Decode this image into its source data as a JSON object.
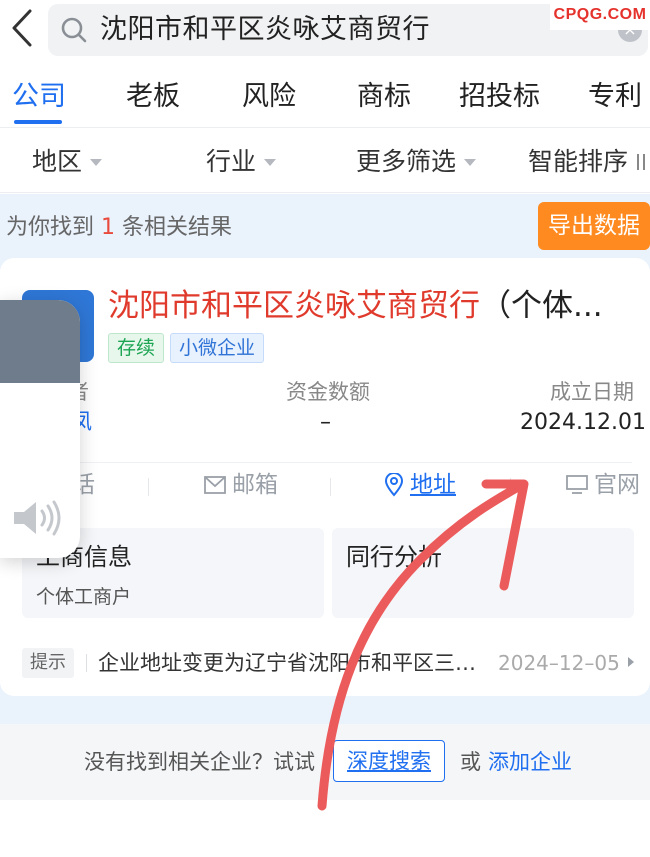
{
  "watermark": "CPQG.COM",
  "search": {
    "query": "沈阳市和平区炎咏艾商贸行",
    "back_icon": "back-arrow-icon",
    "search_icon": "search-icon",
    "clear_icon": "clear-icon",
    "clear_glyph": "×"
  },
  "tabs": [
    {
      "label": "公司",
      "active": true
    },
    {
      "label": "老板"
    },
    {
      "label": "风险"
    },
    {
      "label": "商标"
    },
    {
      "label": "招投标"
    },
    {
      "label": "专利"
    }
  ],
  "filters": [
    {
      "label": "地区"
    },
    {
      "label": "行业"
    },
    {
      "label": "更多筛选"
    },
    {
      "label": "智能排序"
    }
  ],
  "results": {
    "count_prefix": "为你找到 ",
    "count": "1",
    "count_suffix": " 条相关结果",
    "export_label": "导出数据"
  },
  "company": {
    "name": "沈阳市和平区炎咏艾商贸行",
    "name_suffix": "（个体...",
    "status_badge": "存续",
    "scale_badge": "小微企业",
    "legal_label": "者",
    "legal_value": "凤",
    "capital_label": "资金数额",
    "capital_value": "–",
    "founded_label": "成立日期",
    "founded_value": "2024.12.01",
    "actions": {
      "phone": "话",
      "email": "邮箱",
      "address": "地址",
      "website": "官网"
    },
    "tiles": {
      "business_title": "工商信息",
      "business_sub": "个体工商户",
      "peer_title": "同行分析"
    },
    "hint": {
      "badge": "提示",
      "text": "企业地址变更为辽宁省沈阳市和平区三…",
      "date": "2024–12–05"
    }
  },
  "footer": {
    "prompt": "没有找到相关企业？试试",
    "deep_search": "深度搜索",
    "or": "或",
    "add_company": "添加企业"
  },
  "colors": {
    "accent": "#1f6ff0",
    "highlight": "#e03a2c",
    "export": "#ff8a1f",
    "annotation_arrow": "#ec5b5b"
  },
  "overlay": {
    "type": "volume",
    "icon": "speaker-icon",
    "level": 0.68
  }
}
